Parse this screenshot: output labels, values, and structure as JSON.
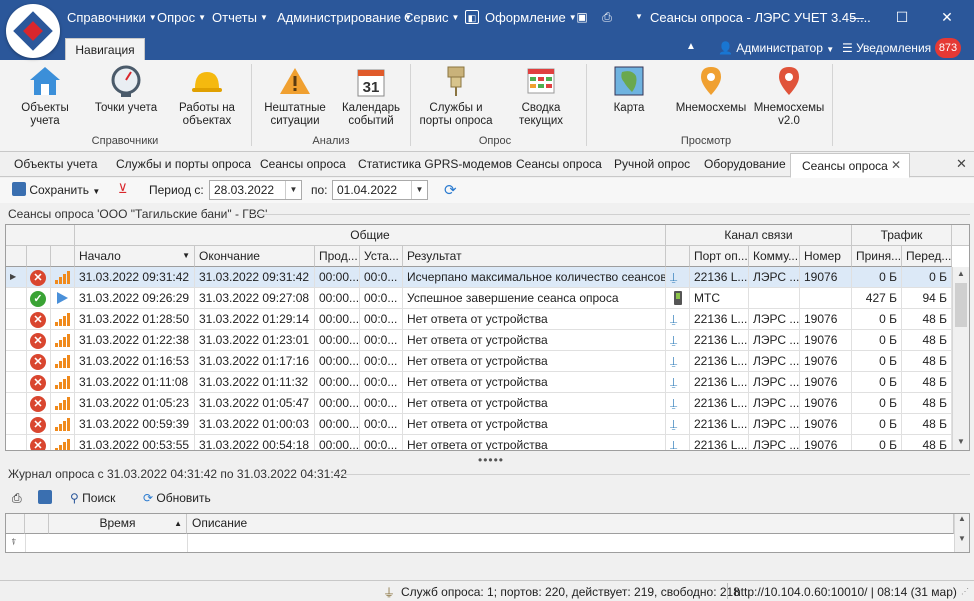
{
  "titlebar": {
    "menu": [
      "Справочники",
      "Опрос",
      "Отчеты",
      "Администрирование",
      "Сервис",
      "Оформление"
    ],
    "window_title": "Сеансы опроса - ЛЭРС УЧЕТ 3.45....",
    "window_buttons": [
      "—",
      "☐",
      "✕"
    ]
  },
  "tabrow": {
    "active_tab": "Навигация",
    "user": "Администратор",
    "notifications_label": "Уведомления",
    "notifications_count": "873"
  },
  "ribbon": {
    "buttons": {
      "objects": "Объекты\nучета",
      "points": "Точки учета",
      "works": "Работы на\nобъектах",
      "emergencies": "Нештатные\nситуации",
      "calendar": "Календарь\nсобытий",
      "calendar_day": "31",
      "services": "Службы и\nпорты опроса",
      "summary": "Сводка\nтекущих",
      "map": "Карта",
      "mnemo": "Мнемосхемы",
      "mnemo2": "Мнемосхемы\nv2.0"
    },
    "groups": {
      "handbooks": "Справочники",
      "analysis": "Анализ",
      "poll": "Опрос",
      "view": "Просмотр"
    }
  },
  "doc_tabs": [
    "Объекты учета",
    "Службы и порты опроса",
    "Сеансы опроса",
    "Статистика GPRS-модемов",
    "Сеансы опроса",
    "Ручной опрос",
    "Оборудование"
  ],
  "doc_tab_active": "Сеансы опроса",
  "toolbar": {
    "save_label": "Сохранить",
    "period_from_label": "Период с:",
    "period_from": "28.03.2022",
    "period_to_label": "по:",
    "period_to": "01.04.2022"
  },
  "sessions": {
    "caption": "Сеансы опроса 'ООО \"Тагильские бани\" - ГВС'",
    "band_headers": {
      "general": "Общие",
      "channel": "Канал связи",
      "traffic": "Трафик"
    },
    "columns": [
      "Начало",
      "Окончание",
      "Прод...",
      "Уста...",
      "Результат",
      "Порт оп...",
      "Комму...",
      "Номер",
      "Приня...",
      "Перед..."
    ],
    "rows": [
      {
        "status": "error",
        "type": "gprs",
        "start": "31.03.2022 09:31:42",
        "end": "31.03.2022 09:31:42",
        "dur": "00:00...",
        "est": "00:0...",
        "result": "Исчерпано максимальное количество сеансов оп...",
        "chan": "antenna",
        "port": "22136 L...",
        "comm": "ЛЭРС ...",
        "num": "19076",
        "rx": "0 Б",
        "tx": "0 Б"
      },
      {
        "status": "ok",
        "type": "play",
        "start": "31.03.2022 09:26:29",
        "end": "31.03.2022 09:27:08",
        "dur": "00:00...",
        "est": "00:0...",
        "result": "Успешное завершение сеанса опроса",
        "chan": "phone",
        "port": "МТС",
        "comm": "",
        "num": "",
        "rx": "427 Б",
        "tx": "94 Б"
      },
      {
        "status": "error",
        "type": "gprs",
        "start": "31.03.2022 01:28:50",
        "end": "31.03.2022 01:29:14",
        "dur": "00:00...",
        "est": "00:0...",
        "result": "Нет ответа от устройства",
        "chan": "antenna",
        "port": "22136 L...",
        "comm": "ЛЭРС ...",
        "num": "19076",
        "rx": "0 Б",
        "tx": "48 Б"
      },
      {
        "status": "error",
        "type": "gprs",
        "start": "31.03.2022 01:22:38",
        "end": "31.03.2022 01:23:01",
        "dur": "00:00...",
        "est": "00:0...",
        "result": "Нет ответа от устройства",
        "chan": "antenna",
        "port": "22136 L...",
        "comm": "ЛЭРС ...",
        "num": "19076",
        "rx": "0 Б",
        "tx": "48 Б"
      },
      {
        "status": "error",
        "type": "gprs",
        "start": "31.03.2022 01:16:53",
        "end": "31.03.2022 01:17:16",
        "dur": "00:00...",
        "est": "00:0...",
        "result": "Нет ответа от устройства",
        "chan": "antenna",
        "port": "22136 L...",
        "comm": "ЛЭРС ...",
        "num": "19076",
        "rx": "0 Б",
        "tx": "48 Б"
      },
      {
        "status": "error",
        "type": "gprs",
        "start": "31.03.2022 01:11:08",
        "end": "31.03.2022 01:11:32",
        "dur": "00:00...",
        "est": "00:0...",
        "result": "Нет ответа от устройства",
        "chan": "antenna",
        "port": "22136 L...",
        "comm": "ЛЭРС ...",
        "num": "19076",
        "rx": "0 Б",
        "tx": "48 Б"
      },
      {
        "status": "error",
        "type": "gprs",
        "start": "31.03.2022 01:05:23",
        "end": "31.03.2022 01:05:47",
        "dur": "00:00...",
        "est": "00:0...",
        "result": "Нет ответа от устройства",
        "chan": "antenna",
        "port": "22136 L...",
        "comm": "ЛЭРС ...",
        "num": "19076",
        "rx": "0 Б",
        "tx": "48 Б"
      },
      {
        "status": "error",
        "type": "gprs",
        "start": "31.03.2022 00:59:39",
        "end": "31.03.2022 01:00:03",
        "dur": "00:00...",
        "est": "00:0...",
        "result": "Нет ответа от устройства",
        "chan": "antenna",
        "port": "22136 L...",
        "comm": "ЛЭРС ...",
        "num": "19076",
        "rx": "0 Б",
        "tx": "48 Б"
      },
      {
        "status": "error",
        "type": "gprs",
        "start": "31.03.2022 00:53:55",
        "end": "31.03.2022 00:54:18",
        "dur": "00:00...",
        "est": "00:0...",
        "result": "Нет ответа от устройства",
        "chan": "antenna",
        "port": "22136 L...",
        "comm": "ЛЭРС ...",
        "num": "19076",
        "rx": "0 Б",
        "tx": "48 Б"
      }
    ]
  },
  "journal": {
    "caption": "Журнал опроса с 31.03.2022 04:31:42 по 31.03.2022 04:31:42",
    "search_label": "Поиск",
    "refresh_label": "Обновить",
    "col_time": "Время",
    "col_desc": "Описание"
  },
  "statusbar": {
    "services": "Служб опроса: 1; портов: 220, действует: 219, свободно: 218",
    "server": "http://10.104.0.60:10010/ | 08:14 (31 мар)"
  },
  "colors": {
    "accent": "#2b579a",
    "error": "#d9462f",
    "ok": "#3aa335",
    "badge": "#e53935",
    "signal": "#f08a1c"
  }
}
